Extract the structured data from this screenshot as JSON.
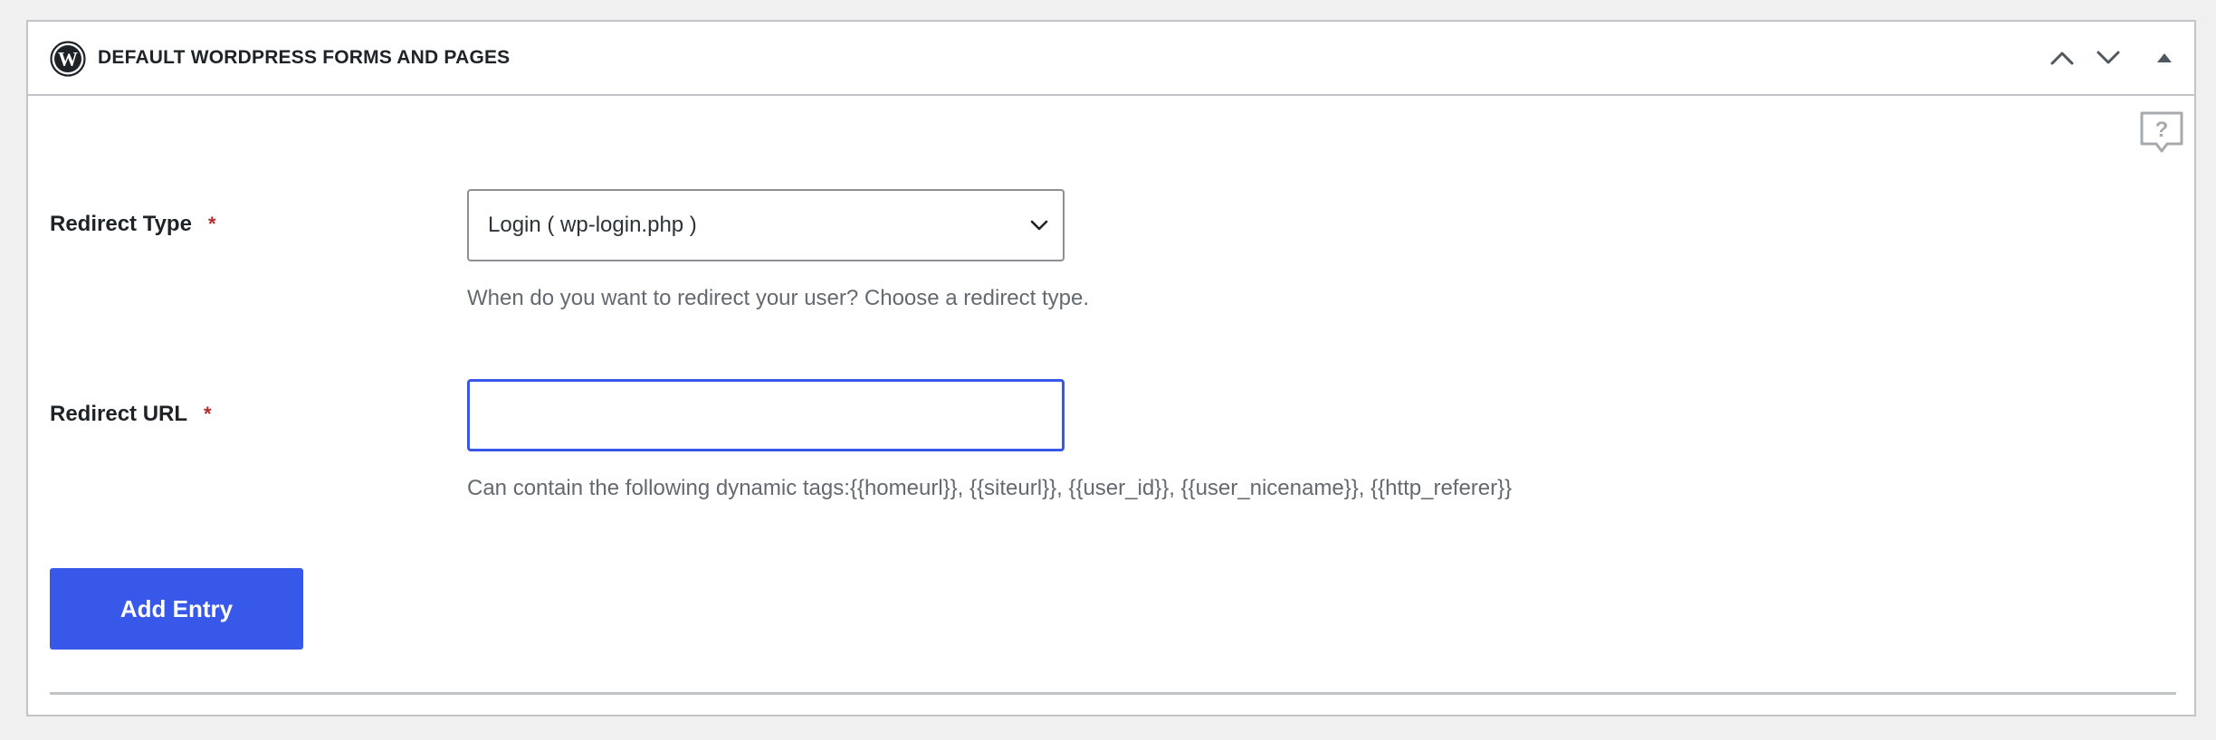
{
  "panel": {
    "title": "Default WordPress Forms and Pages",
    "icons": {
      "logo": "wordpress-logo-icon",
      "move_up": "chevron-up-icon",
      "move_down": "chevron-down-icon",
      "toggle": "triangle-up-icon",
      "help": "help-speech-bubble-icon"
    }
  },
  "form": {
    "redirect_type": {
      "label": "Redirect Type",
      "required_mark": "*",
      "selected_value": "Login ( wp-login.php )",
      "help": "When do you want to redirect your user? Choose a redirect type."
    },
    "redirect_url": {
      "label": "Redirect URL",
      "required_mark": "*",
      "value": "",
      "help": "Can contain the following dynamic tags:{{homeurl}}, {{siteurl}}, {{user_id}}, {{user_nicename}}, {{http_referer}}"
    },
    "add_entry_label": "Add Entry"
  },
  "colors": {
    "accent": "#3858e9",
    "required": "#b32d2e",
    "border": "#c3c4c7",
    "help_text": "#646970"
  }
}
